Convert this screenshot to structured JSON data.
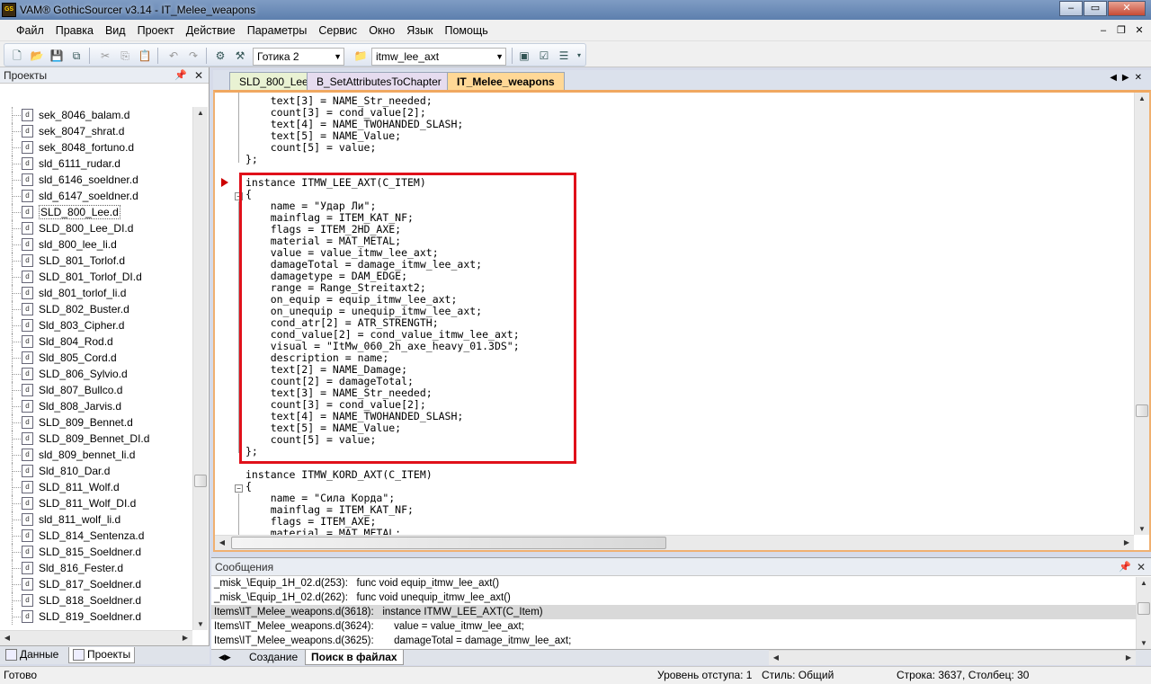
{
  "window": {
    "title": "VAM® GothicSourcer v3.14 - IT_Melee_weapons",
    "icon": "app-logo-icon",
    "controls": {
      "minimize": "–",
      "restore": "▭",
      "close": "✕"
    }
  },
  "menu": [
    "Файл",
    "Правка",
    "Вид",
    "Проект",
    "Действие",
    "Параметры",
    "Сервис",
    "Окно",
    "Язык",
    "Помощь"
  ],
  "toolbar": {
    "game_combo": "Готика 2",
    "symbol_combo": "itmw_lee_axt"
  },
  "projects_panel": {
    "title": "Проекты",
    "selected": "SLD_800_Lee.d",
    "files": [
      "sek_8046_balam.d",
      "sek_8047_shrat.d",
      "sek_8048_fortuno.d",
      "sld_6111_rudar.d",
      "sld_6146_soeldner.d",
      "sld_6147_soeldner.d",
      "SLD_800_Lee.d",
      "SLD_800_Lee_DI.d",
      "sld_800_lee_li.d",
      "SLD_801_Torlof.d",
      "SLD_801_Torlof_DI.d",
      "sld_801_torlof_li.d",
      "SLD_802_Buster.d",
      "Sld_803_Cipher.d",
      "Sld_804_Rod.d",
      "Sld_805_Cord.d",
      "SLD_806_Sylvio.d",
      "Sld_807_Bullco.d",
      "Sld_808_Jarvis.d",
      "SLD_809_Bennet.d",
      "SLD_809_Bennet_DI.d",
      "sld_809_bennet_li.d",
      "Sld_810_Dar.d",
      "SLD_811_Wolf.d",
      "SLD_811_Wolf_DI.d",
      "sld_811_wolf_li.d",
      "SLD_814_Sentenza.d",
      "SLD_815_Soeldner.d",
      "Sld_816_Fester.d",
      "SLD_817_Soeldner.d",
      "SLD_818_Soeldner.d",
      "SLD_819_Soeldner.d"
    ],
    "bottom_tabs": [
      "Данные",
      "Проекты"
    ]
  },
  "doc_tabs": [
    "SLD_800_Lee",
    "B_SetAttributesToChapter",
    "IT_Melee_weapons"
  ],
  "code_lines": [
    "    text[3] = NAME_Str_needed;",
    "    count[3] = cond_value[2];",
    "    text[4] = NAME_TWOHANDED_SLASH;",
    "    text[5] = NAME_Value;",
    "    count[5] = value;",
    "};",
    "",
    "instance ITMW_LEE_AXT(C_ITEM)",
    "{",
    "    name = \"Удар Ли\";",
    "    mainflag = ITEM_KAT_NF;",
    "    flags = ITEM_2HD_AXE;",
    "    material = MAT_METAL;",
    "    value = value_itmw_lee_axt;",
    "    damageTotal = damage_itmw_lee_axt;",
    "    damagetype = DAM_EDGE;",
    "    range = Range_Streitaxt2;",
    "    on_equip = equip_itmw_lee_axt;",
    "    on_unequip = unequip_itmw_lee_axt;",
    "    cond_atr[2] = ATR_STRENGTH;",
    "    cond_value[2] = cond_value_itmw_lee_axt;",
    "    visual = \"ItMw_060_2h_axe_heavy_01.3DS\";",
    "    description = name;",
    "    text[2] = NAME_Damage;",
    "    count[2] = damageTotal;",
    "    text[3] = NAME_Str_needed;",
    "    count[3] = cond_value[2];",
    "    text[4] = NAME_TWOHANDED_SLASH;",
    "    text[5] = NAME_Value;",
    "    count[5] = value;",
    "};",
    "",
    "instance ITMW_KORD_AXT(C_ITEM)",
    "{",
    "    name = \"Сила Корда\";",
    "    mainflag = ITEM_KAT_NF;",
    "    flags = ITEM_AXE;",
    "    material = MAT_METAL;"
  ],
  "messages_panel": {
    "title": "Сообщения",
    "rows": [
      {
        "loc": "_misk_\\Equip_1H_02.d(253):",
        "text": "func void equip_itmw_lee_axt()"
      },
      {
        "loc": "_misk_\\Equip_1H_02.d(262):",
        "text": "func void unequip_itmw_lee_axt()"
      },
      {
        "loc": "Items\\IT_Melee_weapons.d(3618):",
        "text": "instance ITMW_LEE_AXT(C_Item)"
      },
      {
        "loc": "Items\\IT_Melee_weapons.d(3624):",
        "text": "    value = value_itmw_lee_axt;"
      },
      {
        "loc": "Items\\IT_Melee_weapons.d(3625):",
        "text": "    damageTotal = damage_itmw_lee_axt;"
      }
    ],
    "selected_row": 2,
    "tabs": [
      "Создание",
      "Поиск в файлах"
    ]
  },
  "statusbar": {
    "ready": "Готово",
    "indent": "Уровень отступа: 1",
    "style": "Стиль: Общий",
    "position": "Строка: 3637, Столбец: 30"
  }
}
